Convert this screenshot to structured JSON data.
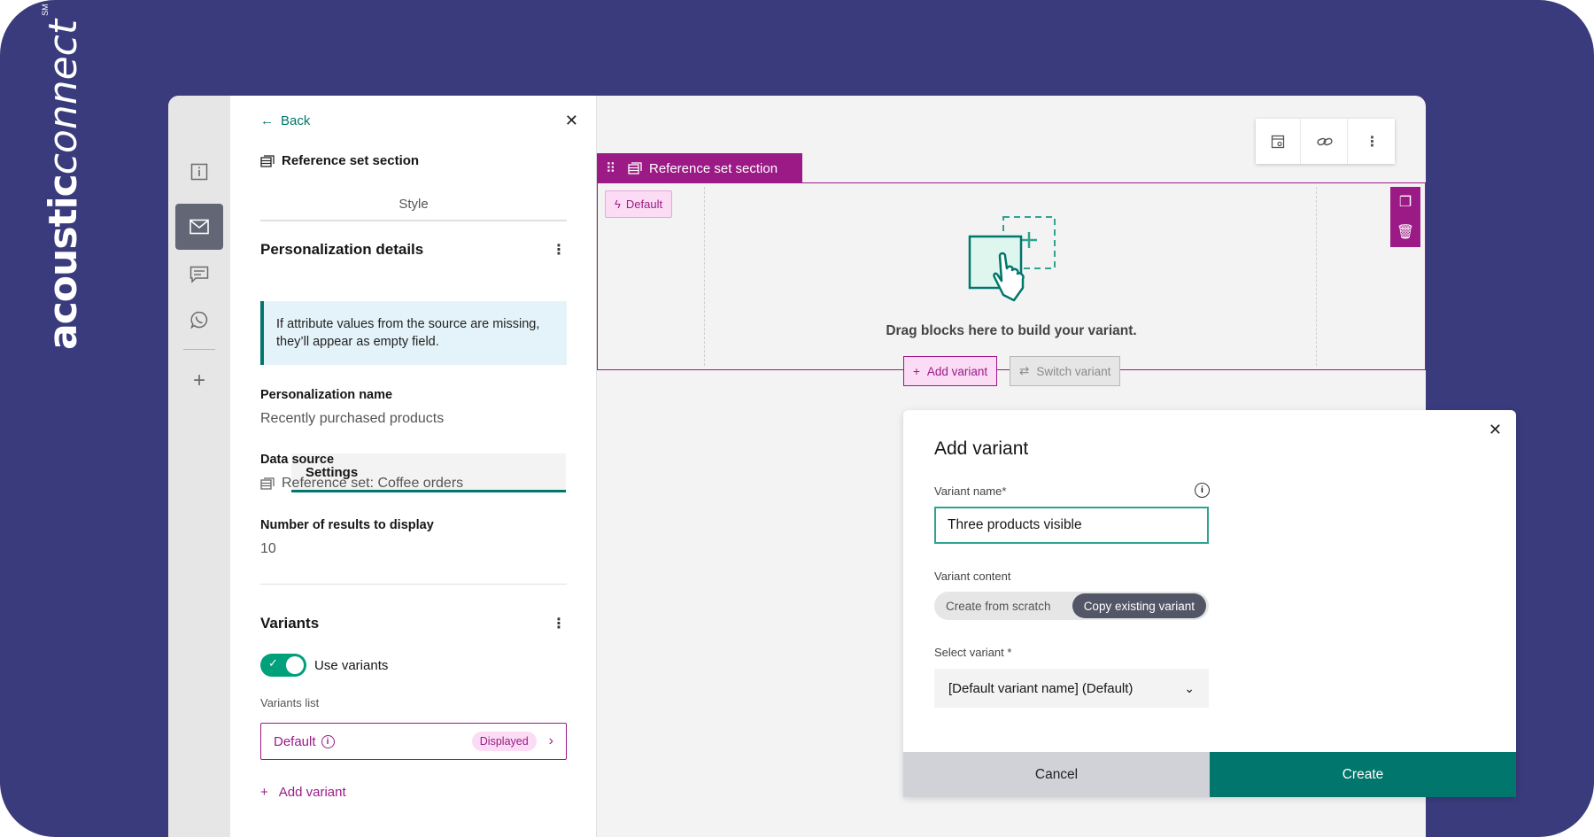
{
  "brand": {
    "bold": "acoustic",
    "light": "connect",
    "mark": "SM"
  },
  "rail": {
    "items": [
      "info-icon",
      "mail-icon",
      "chat-icon",
      "whatsapp-icon",
      "plus-icon"
    ],
    "active": 1
  },
  "panel": {
    "back_label": "Back",
    "title": "Reference set section",
    "tabs": [
      "Settings",
      "Style"
    ],
    "personalization": {
      "heading": "Personalization details",
      "note": "If attribute values from the source are missing, they’ll appear as empty field.",
      "name_label": "Personalization name",
      "name_value": "Recently purchased products",
      "source_label": "Data source",
      "source_value": "Reference set: Coffee orders",
      "results_label": "Number of results to display",
      "results_value": "10"
    },
    "variants": {
      "heading": "Variants",
      "toggle_label": "Use variants",
      "list_label": "Variants list",
      "item_name": "Default",
      "item_badge": "Displayed",
      "add_label": "Add variant"
    }
  },
  "canvas": {
    "section_tab": "Reference set section",
    "default_btn": "Default",
    "drag_text": "Drag blocks here to build your variant.",
    "add_variant": "Add variant",
    "switch_variant": "Switch variant"
  },
  "modal": {
    "title": "Add variant",
    "name_label": "Variant name*",
    "name_value": "Three products visible",
    "content_label": "Variant content",
    "opt_scratch": "Create from scratch",
    "opt_copy": "Copy existing variant",
    "select_label": "Select variant *",
    "select_value": "[Default variant name] (Default)",
    "cancel": "Cancel",
    "create": "Create"
  },
  "colors": {
    "bg": "#3a3b7c",
    "magenta": "#9b1a86",
    "teal": "#00766c"
  }
}
